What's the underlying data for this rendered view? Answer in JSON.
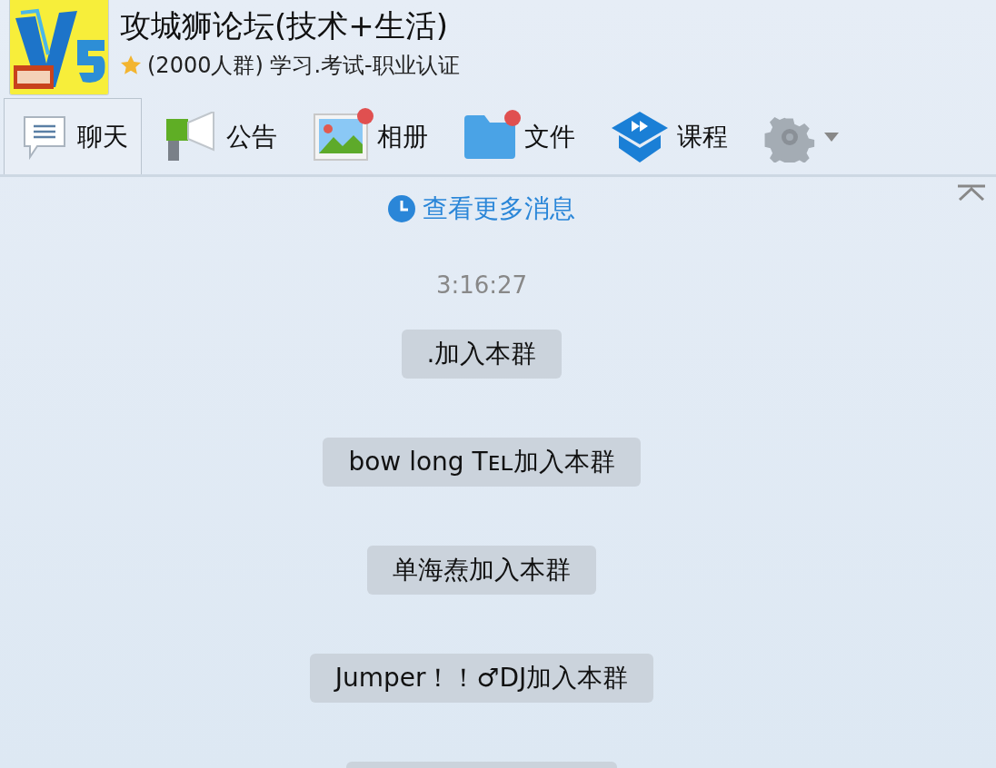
{
  "group": {
    "title": "攻城狮论坛(技术+生活)",
    "subtitle": "(2000人群) 学习.考试-职业认证"
  },
  "tabs": [
    {
      "kind": "chat",
      "label": "聊天",
      "selected": true,
      "badge": false
    },
    {
      "kind": "notice",
      "label": "公告",
      "selected": false,
      "badge": false
    },
    {
      "kind": "album",
      "label": "相册",
      "selected": false,
      "badge": true
    },
    {
      "kind": "files",
      "label": "文件",
      "selected": false,
      "badge": true
    },
    {
      "kind": "course",
      "label": "课程",
      "selected": false,
      "badge": false
    },
    {
      "kind": "settings",
      "selected": false,
      "badge": false
    }
  ],
  "more_messages": "查看更多消息",
  "timestamp": "3:16:27",
  "messages": [
    {
      "text": ".加入本群"
    },
    {
      "text": "bow long Tᴇʟ加入本群"
    },
    {
      "text": "单海焘加入本群"
    },
    {
      "text": "Jumper！！♂DJ加入本群"
    },
    {
      "kind": "cut"
    }
  ]
}
